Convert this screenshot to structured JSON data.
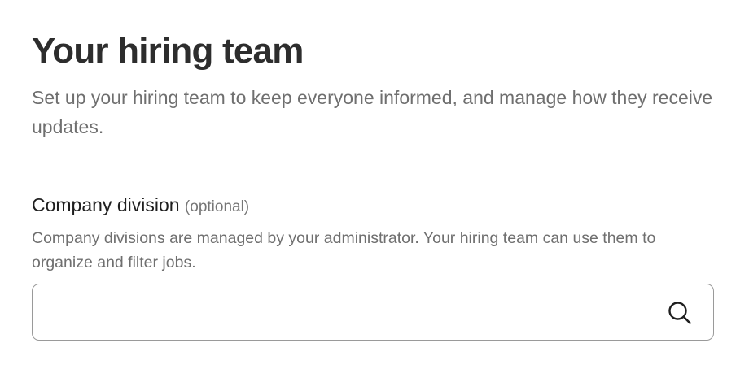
{
  "header": {
    "title": "Your hiring team",
    "subtitle": "Set up your hiring team to keep everyone informed, and manage how they receive updates."
  },
  "company_division": {
    "label": "Company division",
    "optional_tag": "(optional)",
    "help_text": "Company divisions are managed by your administrator. Your hiring team can use them to organize and filter jobs.",
    "input_value": "",
    "placeholder": "",
    "icon": "search-icon"
  },
  "colors": {
    "title": "#2d2d2d",
    "secondary_text": "#6f6f6f",
    "input_border": "#9a9a9a"
  }
}
